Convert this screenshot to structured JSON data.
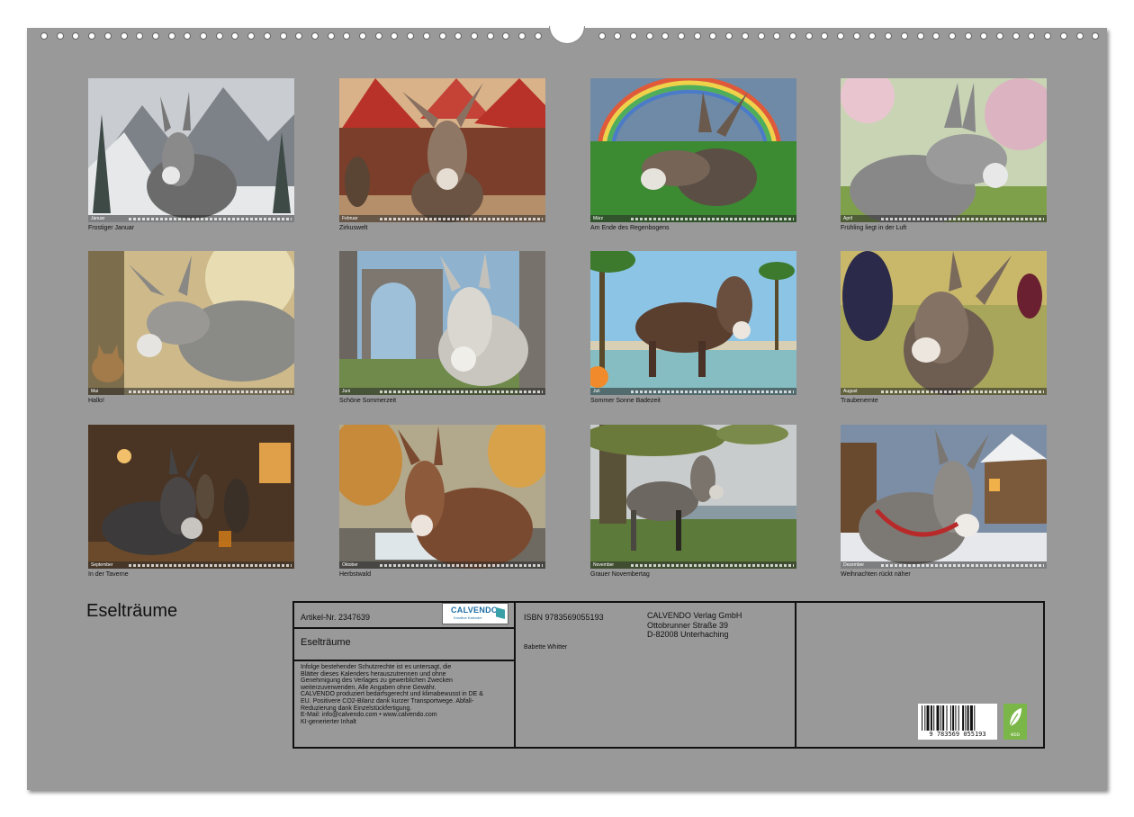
{
  "calendar": {
    "title": "Eselträume",
    "months": [
      {
        "caption": "Frostiger Januar",
        "month_label": "Januar"
      },
      {
        "caption": "Zirkuswelt",
        "month_label": "Februar"
      },
      {
        "caption": "Am Ende des Regenbogens",
        "month_label": "März"
      },
      {
        "caption": "Frühling liegt in der Luft",
        "month_label": "April"
      },
      {
        "caption": "Hallo!",
        "month_label": "Mai"
      },
      {
        "caption": "Schöne Sommerzeit",
        "month_label": "Juni"
      },
      {
        "caption": "Sommer Sonne Badezeit",
        "month_label": "Juli"
      },
      {
        "caption": "Traubenernte",
        "month_label": "August"
      },
      {
        "caption": "In der Taverne",
        "month_label": "September"
      },
      {
        "caption": "Herbstwald",
        "month_label": "Oktober"
      },
      {
        "caption": "Grauer Novembertag",
        "month_label": "November"
      },
      {
        "caption": "Weihnachten rückt näher",
        "month_label": "Dezember"
      }
    ]
  },
  "info": {
    "article": "Artikel-Nr. 2347639",
    "logo_text": "CALVENDO",
    "logo_sub": "Kreative Kalender",
    "product_title": "Eselträume",
    "legal_lines": [
      "Infolge bestehender Schutzrechte ist es untersagt, die",
      "Blätter dieses Kalenders herauszutrennen und ohne",
      "Genehmigung des Verlages zu gewerblichen Zwecken",
      "weiterzuverwenden. Alle Angaben ohne Gewähr.",
      "CALVENDO produziert bedarfsgerecht und klimabewusst in DE &",
      "EU. Positivere CO2-Bilanz dank kurzer Transportwege. Abfall-",
      "Reduzierung dank Einzelstückfertigung.",
      "E-Mail: info@calvendo.com • www.calvendo.com",
      "KI-generierter Inhalt"
    ],
    "isbn": "ISBN 9783569055193",
    "author": "Babette Whitter",
    "publisher_lines": [
      "CALVENDO Verlag GmbH",
      "Ottobrunner Straße 39",
      "D-82008 Unterhaching"
    ],
    "barcode_number": "9 783569 055193",
    "eco_label": "eco"
  }
}
